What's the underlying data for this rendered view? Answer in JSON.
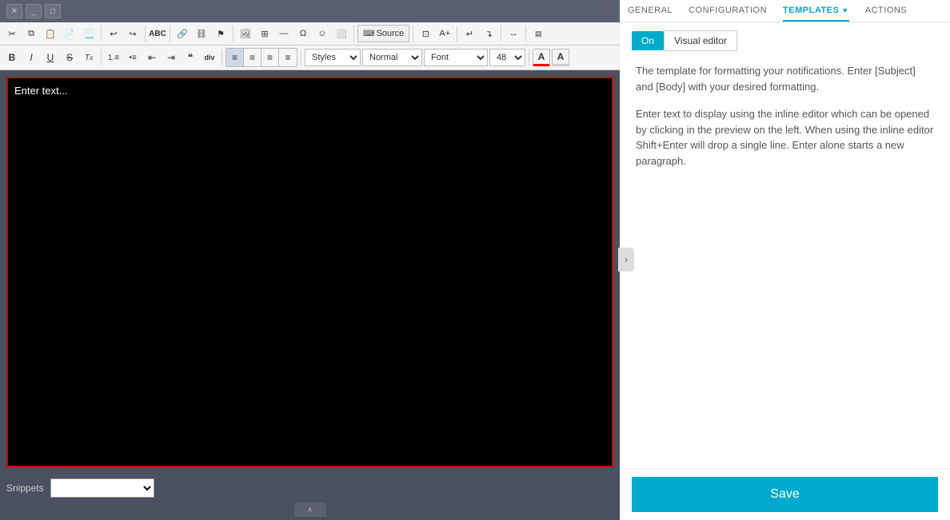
{
  "nav": {
    "general_label": "GENERAL",
    "configuration_label": "CONFIGURATION",
    "templates_label": "TEMPLATES",
    "actions_label": "ACTIONS"
  },
  "toggle": {
    "on_label": "On",
    "visual_editor_label": "Visual editor"
  },
  "toolbar1": {
    "cut": "✂",
    "copy": "⧉",
    "paste_text": "📋",
    "paste_word": "📄",
    "paste_from_word": "📄",
    "undo": "↩",
    "redo": "↪",
    "spell_check": "ABC",
    "link": "🔗",
    "unlink": "🔗",
    "anchor": "⚑",
    "image": "🖼",
    "table": "⊞",
    "horizontal_rule": "—",
    "special_char": "Ω",
    "smiley": "☺",
    "iframe": "⬜",
    "source": "Source",
    "maximize": "⛶"
  },
  "toolbar2": {
    "bold": "B",
    "italic": "I",
    "underline": "U",
    "strikethrough": "S",
    "clear_format": "Tx",
    "ordered_list": "1.",
    "unordered_list": "•",
    "outdent": "⇤",
    "indent": "⇥",
    "blockquote": "❝",
    "div": "div",
    "align_left": "≡",
    "align_center": "≡",
    "align_right": "≡",
    "align_justify": "≡",
    "styles_label": "Styles",
    "normal_label": "Normal",
    "font_label": "Font",
    "size_value": "48",
    "font_color_label": "A",
    "font_bg_label": "A"
  },
  "editor": {
    "placeholder": "Enter text...",
    "border_color": "#cc0000"
  },
  "snippets": {
    "label": "Snippets",
    "placeholder": ""
  },
  "description": {
    "line1": "The template for formatting your notifications. Enter [Subject] and [Body] with your desired formatting.",
    "line2": "Enter text to display using the inline editor which can be opened by clicking in the preview on the left. When using the inline editor Shift+Enter will drop a single line. Enter alone starts a new paragraph."
  },
  "save": {
    "label": "Save"
  },
  "expand_arrow": "›",
  "collapse_arrow": "∧"
}
